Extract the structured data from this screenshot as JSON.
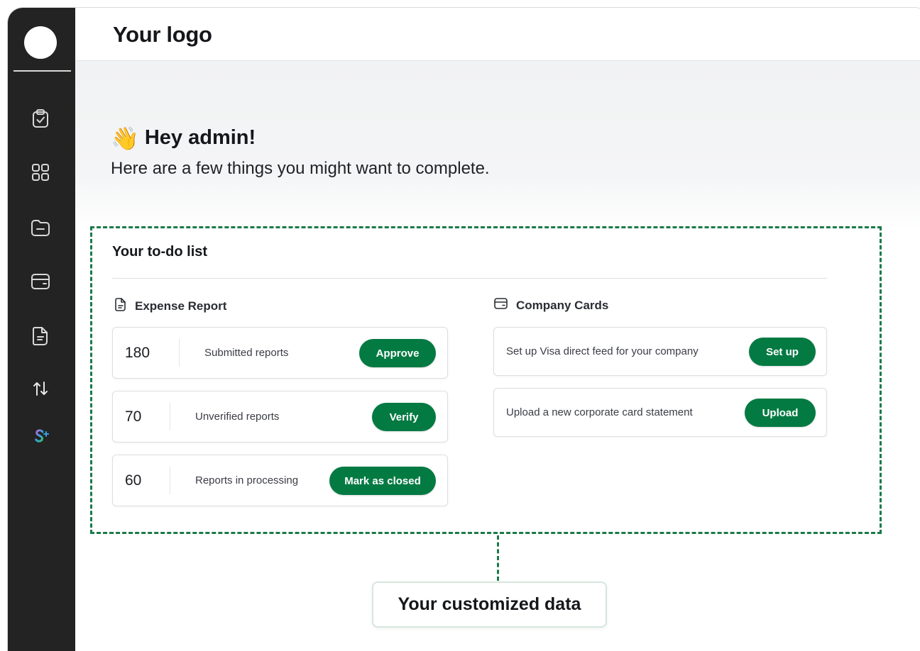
{
  "header": {
    "logo_text": "Your logo"
  },
  "sidebar": {
    "items": [
      {
        "icon": "clipboard-check-icon"
      },
      {
        "icon": "grid-icon"
      },
      {
        "icon": "folder-icon"
      },
      {
        "icon": "wallet-icon"
      },
      {
        "icon": "document-icon"
      },
      {
        "icon": "transfer-arrows-icon"
      },
      {
        "icon": "brand-s-sparkle-icon"
      }
    ]
  },
  "greeting": {
    "emoji": "👋",
    "title": "Hey admin!",
    "subtitle": "Here are a few things you might want to complete."
  },
  "todo": {
    "title": "Your to-do list",
    "expense_report": {
      "heading": "Expense Report",
      "rows": [
        {
          "count": "180",
          "label": "Submitted reports",
          "action": "Approve"
        },
        {
          "count": "70",
          "label": "Unverified reports",
          "action": "Verify"
        },
        {
          "count": "60",
          "label": "Reports in processing",
          "action": "Mark as closed"
        }
      ]
    },
    "company_cards": {
      "heading": "Company Cards",
      "rows": [
        {
          "label": "Set up Visa direct feed for your company",
          "action": "Set up"
        },
        {
          "label": "Upload a new corporate card statement",
          "action": "Upload"
        }
      ]
    }
  },
  "callout": {
    "label": "Your customized data"
  },
  "colors": {
    "accent": "#047a43",
    "dashed": "#1a7a4a",
    "sidebar": "#232323"
  }
}
